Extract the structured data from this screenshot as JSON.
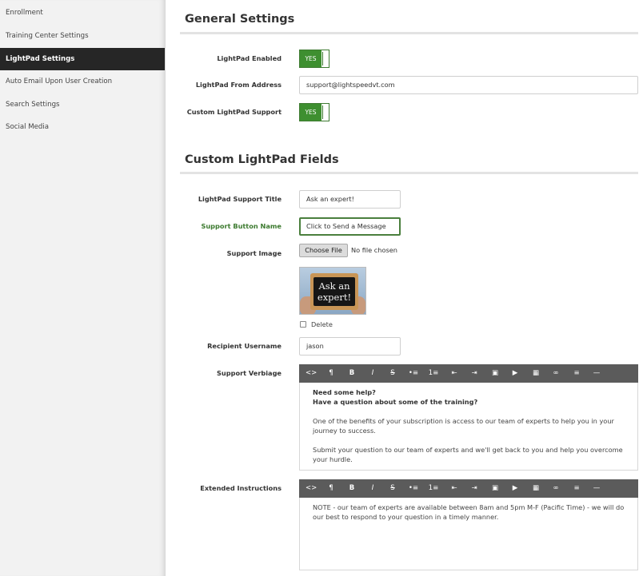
{
  "sidebar": {
    "items": [
      {
        "label": "Enrollment"
      },
      {
        "label": "Training Center Settings"
      },
      {
        "label": "LightPad Settings"
      },
      {
        "label": "Auto Email Upon User Creation"
      },
      {
        "label": "Search Settings"
      },
      {
        "label": "Social Media"
      }
    ]
  },
  "general": {
    "title": "General Settings",
    "lightpad_enabled_label": "LightPad Enabled",
    "lightpad_enabled_value": "YES",
    "from_address_label": "LightPad From Address",
    "from_address_value": "support@lightspeedvt.com",
    "custom_support_label": "Custom LightPad Support",
    "custom_support_value": "YES"
  },
  "custom": {
    "title": "Custom LightPad Fields",
    "support_title_label": "LightPad Support Title",
    "support_title_value": "Ask an expert!",
    "button_name_label": "Support Button Name",
    "button_name_value": "Click to Send a Message",
    "support_image_label": "Support Image",
    "choose_file_label": "Choose File",
    "no_file_text": "No file chosen",
    "image_text_line1": "Ask an",
    "image_text_line2": "expert!",
    "delete_label": "Delete",
    "recipient_label": "Recipient Username",
    "recipient_value": "jason",
    "verbiage_label": "Support Verbiage",
    "verbiage": {
      "bold_line1": "Need some help?",
      "bold_line2": "Have a question about some of the training?",
      "para1": "One of the benefits of your subscription is access to our team of experts to help you in your journey to success.",
      "para2": "Submit your question to our team of experts and we'll get back to you and help you overcome your hurdle."
    },
    "extended_label": "Extended Instructions",
    "extended_text": "NOTE - our team of experts are available between 8am and 5pm M-F (Pacific Time) - we will do our best to respond to your question in a timely manner."
  },
  "toolbar": {
    "icons": [
      "<>",
      "¶",
      "B",
      "I",
      "S",
      "•≡",
      "1≡",
      "⇤",
      "⇥",
      "▣",
      "▶",
      "▦",
      "∞",
      "≡",
      "—"
    ],
    "icon_names": [
      "code-view-icon",
      "paragraph-icon",
      "bold-icon",
      "italic-icon",
      "strikethrough-icon",
      "bullet-list-icon",
      "numbered-list-icon",
      "outdent-icon",
      "indent-icon",
      "image-icon",
      "video-icon",
      "table-icon",
      "link-icon",
      "align-icon",
      "horizontal-rule-icon"
    ]
  },
  "colors": {
    "toggle_green": "#3e8f30",
    "sidebar_active": "#262626",
    "toolbar_bg": "#5b5b5b"
  }
}
